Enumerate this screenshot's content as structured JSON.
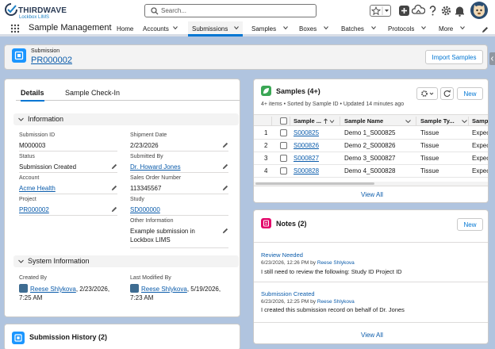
{
  "header": {
    "logo_word": "THIRDWAVE",
    "logo_sub": "Lockbox LIMS",
    "search_placeholder": "Search..."
  },
  "nav": {
    "app_name": "Sample Management",
    "items": [
      {
        "label": "Home",
        "chevron": false
      },
      {
        "label": "Accounts",
        "chevron": true
      },
      {
        "label": "Submissions",
        "chevron": true,
        "active": true
      },
      {
        "label": "Samples",
        "chevron": true
      },
      {
        "label": "Boxes",
        "chevron": true
      },
      {
        "label": "Batches",
        "chevron": true
      },
      {
        "label": "Protocols",
        "chevron": true
      },
      {
        "label": "More",
        "chevron": true
      }
    ]
  },
  "record": {
    "type": "Submission",
    "name": "PR000002",
    "import_button": "Import Samples"
  },
  "details": {
    "tabs": [
      "Details",
      "Sample Check-In"
    ],
    "info_section": "Information",
    "sysinfo_section": "System Information",
    "fields": {
      "submission_id_label": "Submission ID",
      "submission_id": "M000003",
      "shipment_date_label": "Shipment Date",
      "shipment_date": "2/23/2026",
      "status_label": "Status",
      "status": "Submission Created",
      "submitted_by_label": "Submitted By",
      "submitted_by": "Dr. Howard Jones",
      "account_label": "Account",
      "account": "Acme Health",
      "sales_order_label": "Sales Order Number",
      "sales_order": "113345567",
      "project_label": "Project",
      "project": "PR000002",
      "study_label": "Study",
      "study": "SD000000",
      "other_info_label": "Other Information",
      "other_info": "Example submission in Lockbox LIMS"
    },
    "system": {
      "created_by_label": "Created By",
      "created_by_name": "Reese Shlykova",
      "created_by_date": ", 2/23/2026,",
      "created_by_time": "7:25 AM",
      "modified_by_label": "Last Modified By",
      "modified_by_name": "Reese Shlykova",
      "modified_by_date": ", 5/19/2026,",
      "modified_by_time": "7:23 AM"
    }
  },
  "history": {
    "title": "Submission History (2)"
  },
  "samples": {
    "title": "Samples (4+)",
    "subtitle": "4+ items • Sorted by Sample ID • Updated 14 minutes ago",
    "new_button": "New",
    "columns": [
      "Sample ...",
      "Sample Name",
      "Sample Ty...",
      "Sampl"
    ],
    "rows": [
      {
        "num": "1",
        "id": "S000825",
        "name": "Demo 1_S000825",
        "type": "Tissue",
        "status": "Expect"
      },
      {
        "num": "2",
        "id": "S000826",
        "name": "Demo 2_S000826",
        "type": "Tissue",
        "status": "Expect"
      },
      {
        "num": "3",
        "id": "S000827",
        "name": "Demo 3_S000827",
        "type": "Tissue",
        "status": "Expect"
      },
      {
        "num": "4",
        "id": "S000828",
        "name": "Demo 4_S000828",
        "type": "Tissue",
        "status": "Expect"
      }
    ],
    "view_all": "View All"
  },
  "notes": {
    "title": "Notes (2)",
    "new_button": "New",
    "items": [
      {
        "title": "Review Needed",
        "meta": "6/23/2026, 12:26 PM by ",
        "author": "Reese Shlykova",
        "body": "I still need to review the following: Study ID Project ID"
      },
      {
        "title": "Submission Created",
        "meta": "6/23/2026, 12:25 PM by ",
        "author": "Reese Shlykova",
        "body": "I created this submission record on behalf of Dr. Jones"
      }
    ],
    "view_all": "View All"
  },
  "colors": {
    "brand": "#0176d3",
    "link": "#0b5cab",
    "background": "#b0c4df"
  }
}
